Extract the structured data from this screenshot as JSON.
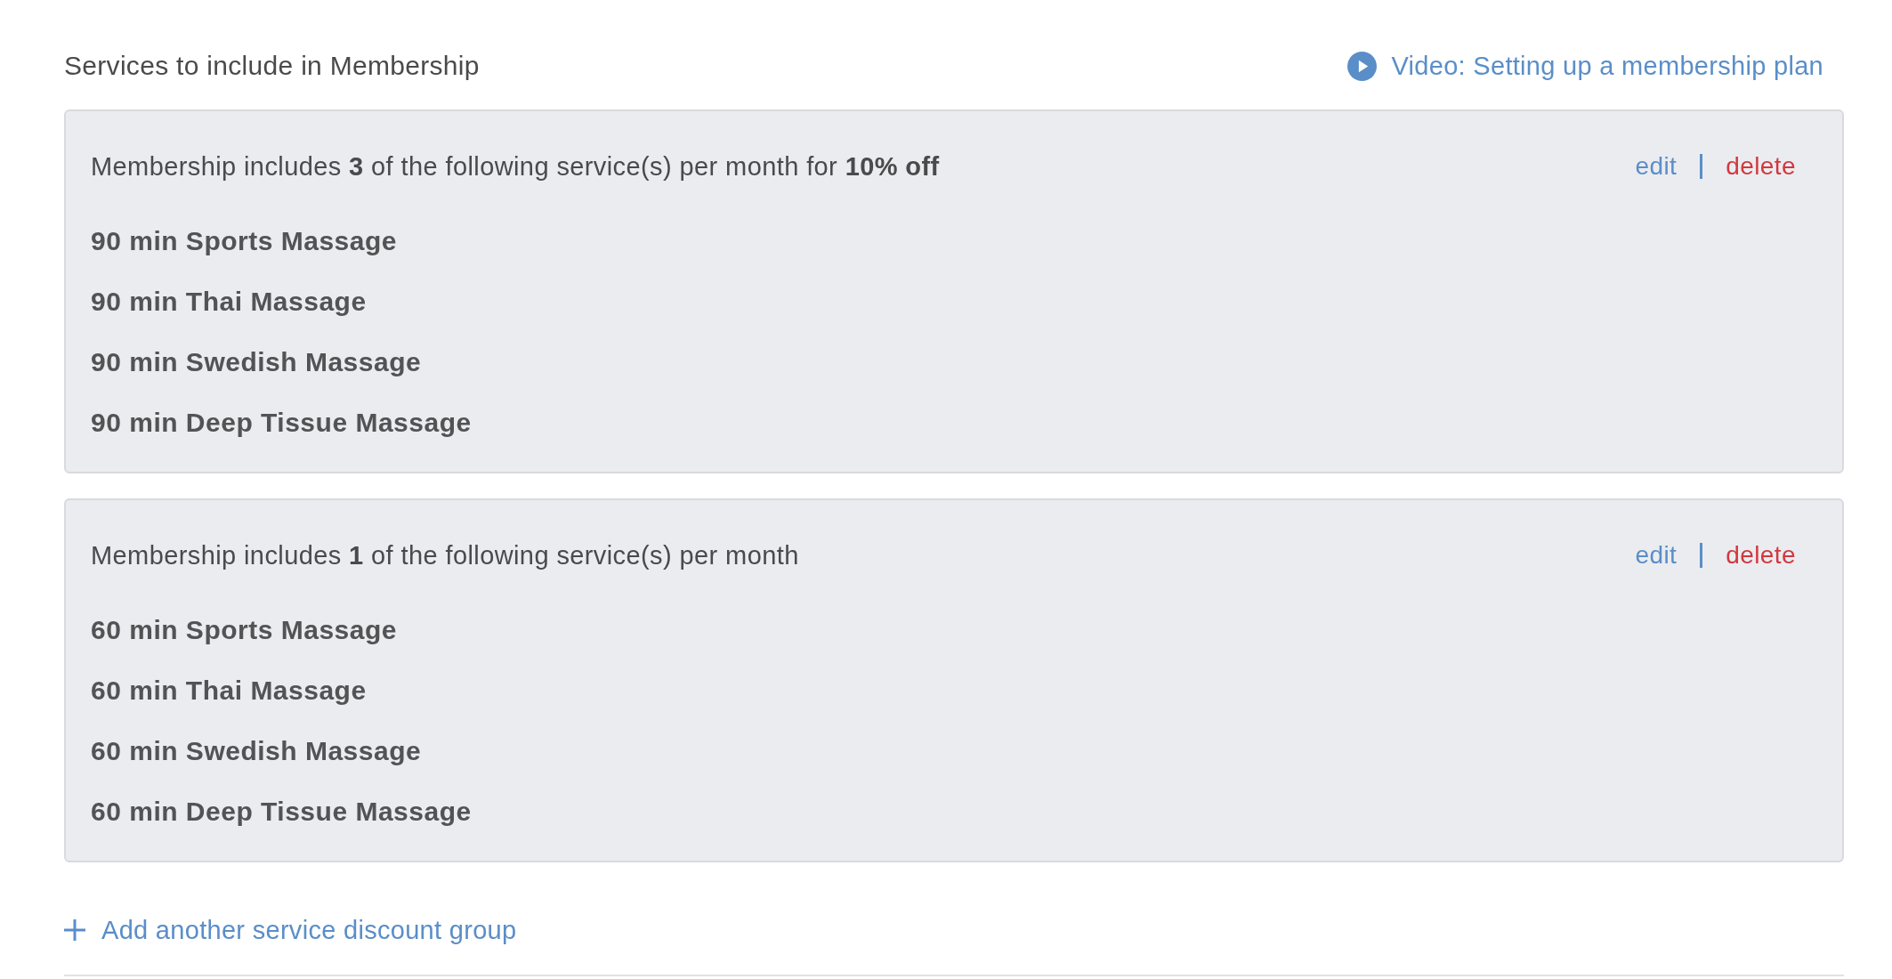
{
  "header": {
    "title": "Services to include in Membership",
    "video_link": "Video: Setting up a membership plan"
  },
  "groups": [
    {
      "summary": "Membership includes **3** of the following service(s) per month for **10% off**",
      "actions": [
        {
          "label": "edit",
          "kind": "edit"
        },
        {
          "label": "delete",
          "kind": "delete"
        }
      ],
      "services": [
        "90 min Sports Massage",
        "90 min Thai Massage",
        "90 min Swedish Massage",
        "90 min Deep Tissue Massage"
      ]
    },
    {
      "summary": "Membership includes **1** of the following service(s) per month",
      "actions": [
        {
          "label": "edit",
          "kind": "edit"
        },
        {
          "label": "delete",
          "kind": "delete"
        }
      ],
      "services": [
        "60 min Sports Massage",
        "60 min Thai Massage",
        "60 min Swedish Massage",
        "60 min Deep Tissue Massage"
      ]
    }
  ],
  "add_link": "Add another service discount group"
}
